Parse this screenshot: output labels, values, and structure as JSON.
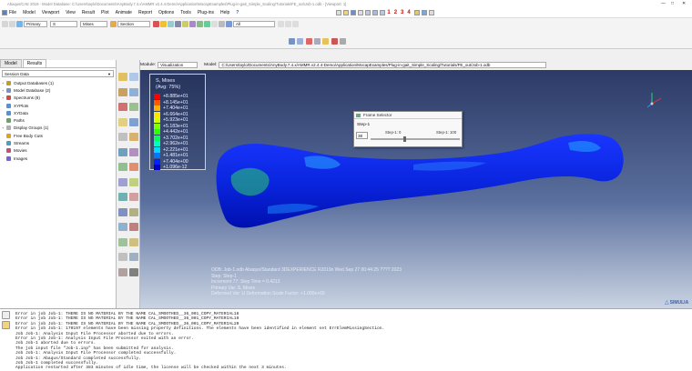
{
  "titlebar": {
    "text": "Abaqus/CAE 2019 - Model Database: C:\\Users\\taylo\\Documents\\AnyBody.7.4.x\\AMMR.v2.4.4-Demo\\Application\\MocapExamples\\Plug-in-gait_Simple_Scaling\\Tutorials\\FE_out\\Job-1.odb - [Viewport: 1]"
  },
  "menu": {
    "items": [
      "File",
      "Model",
      "Viewport",
      "View",
      "Result",
      "Plot",
      "Animate",
      "Report",
      "Options",
      "Tools",
      "Plug-ins",
      "Help"
    ],
    "help_glyph": "?",
    "view_numbers": [
      "1",
      "2",
      "3",
      "4"
    ]
  },
  "toolbar2": {
    "output_type": "Primary",
    "field": "S",
    "invariant": "Mises",
    "section_point": "Section",
    "ok_label": "All"
  },
  "left_panel": {
    "tabs": [
      "Model",
      "Results"
    ],
    "combo": "Session Data",
    "tree": [
      {
        "label": "Output Databases (1)",
        "expand": "+"
      },
      {
        "label": "Model Database (2)",
        "expand": "+"
      },
      {
        "label": "Spectrums (8)",
        "expand": "+"
      },
      {
        "label": "XYPlots",
        "expand": ""
      },
      {
        "label": "XYData",
        "expand": ""
      },
      {
        "label": "Paths",
        "expand": ""
      },
      {
        "label": "Display Groups (1)",
        "expand": "+"
      },
      {
        "label": "Free Body Cuts",
        "expand": ""
      },
      {
        "label": "Streams",
        "expand": ""
      },
      {
        "label": "Movies",
        "expand": ""
      },
      {
        "label": "Images",
        "expand": ""
      }
    ]
  },
  "viewport_bar": {
    "module_label": "Module:",
    "module_value": "Visualization",
    "model_label": "Model:",
    "model_value": "C:/Users/taylo/Documents/AnyBody.7.4.x/AMMR.v2.4.4-Demo/Application/MocapExamples/Plug-in-gait_Simple_Scaling/Tutorials/FE_out/Job-1.odb"
  },
  "legend": {
    "title": "S, Mises",
    "subtitle": "(Avg: 75%)",
    "values": [
      "+8.885e+01",
      "+8.145e+01",
      "+7.404e+01",
      "+6.664e+01",
      "+5.923e+01",
      "+5.183e+01",
      "+4.442e+01",
      "+3.702e+01",
      "+2.962e+01",
      "+2.221e+01",
      "+1.481e+01",
      "+7.404e+00",
      "+1.096e-12"
    ],
    "colors": [
      "#ff0000",
      "#ff5a00",
      "#ffb000",
      "#ffe400",
      "#d4ff00",
      "#82ff00",
      "#2cff00",
      "#00ff5c",
      "#00ffbe",
      "#00d8ff",
      "#0076ff",
      "#0024ff",
      "#0000c4"
    ]
  },
  "frame_dialog": {
    "title": "Frame Selector",
    "step_label": "Step-1",
    "frame_value": "38",
    "step_lo": "Step-1: 0",
    "step_hi": "Step-1: 100",
    "slider_fraction": 0.38
  },
  "viewport_info": {
    "odb_line": "ODB: Job-1.odb    Abaqus/Standard 3DEXPERIENCE R2019x    Wed Sep 27 00:44:25 ???? 2023",
    "lines": [
      "Step: Step-1",
      "Increment    77: Step Time =    0.4213",
      "Primary Var: S, Mises",
      "Deformed Var: U   Deformation Scale Factor: +1.000e+00"
    ]
  },
  "brand": {
    "name": "SIMULIA",
    "color": "#3b5fb3"
  },
  "messages": [
    "Error in job Job-1: THERE IS NO MATERIAL BY THE NAME CAL_SMOOTHED__36_001_COPY_MATERIAL18",
    "Error in job Job-1: THERE IS NO MATERIAL BY THE NAME CAL_SMOOTHED__36_001_COPY_MATERIAL19",
    "Error in job Job-1: THERE IS NO MATERIAL BY THE NAME CAL_SMOOTHED__36_001_COPY_MATERIAL20",
    "Error in job Job-1: 170197 elements have been missing property definitions. The elements have been identified in element set ErrElemMissingSection.",
    "Job Job-1: Analysis Input File Processor aborted due to errors.",
    "Error in job Job-1: Analysis Input File Processor exited with an error.",
    "Job Job-1 aborted due to errors.",
    "The job input file \"Job-1.inp\" has been submitted for analysis.",
    "Job Job-1: Analysis Input File Processor completed successfully.",
    "Job Job-1: Abaqus/Standard completed successfully.",
    "Job Job-1 completed successfully.",
    "Application restarted after 383 minutes of idle time, the license will be checked within the next 3 minutes."
  ]
}
